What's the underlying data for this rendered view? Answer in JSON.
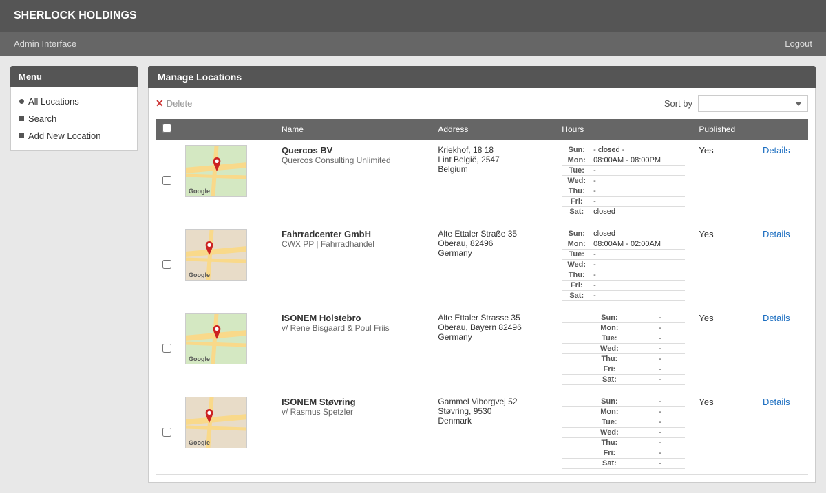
{
  "app": {
    "title": "SHERLOCK HOLDINGS",
    "sub_label": "Admin Interface",
    "logout_label": "Logout"
  },
  "sidebar": {
    "menu_label": "Menu",
    "items": [
      {
        "id": "all-locations",
        "label": "All Locations",
        "bullet": "circle"
      },
      {
        "id": "search",
        "label": "Search",
        "bullet": "square"
      },
      {
        "id": "add-new-location",
        "label": "Add New Location",
        "bullet": "square"
      }
    ]
  },
  "content": {
    "header": "Manage Locations",
    "toolbar": {
      "delete_label": "Delete",
      "sort_by_label": "Sort by"
    },
    "table": {
      "columns": [
        "",
        "",
        "Name",
        "Address",
        "Hours",
        "Published",
        ""
      ],
      "rows": [
        {
          "id": 1,
          "name": "Quercos BV",
          "subtitle": "Quercos Consulting Unlimited",
          "address_line1": "Kriekhof, 18 18",
          "address_line2": "Lint België, 2547",
          "address_line3": "Belgium",
          "hours": [
            {
              "day": "Sun:",
              "time": "- closed -"
            },
            {
              "day": "Mon:",
              "time": "08:00AM - 08:00PM"
            },
            {
              "day": "Tue:",
              "time": "-"
            },
            {
              "day": "Wed:",
              "time": "-"
            },
            {
              "day": "Thu:",
              "time": "-"
            },
            {
              "day": "Fri:",
              "time": "-"
            },
            {
              "day": "Sat:",
              "time": "closed"
            }
          ],
          "published": "Yes",
          "details": "Details"
        },
        {
          "id": 2,
          "name": "Fahrradcenter GmbH",
          "subtitle": "CWX PP | Fahrradhandel",
          "address_line1": "Alte Ettaler Straße 35",
          "address_line2": "Oberau, 82496",
          "address_line3": "Germany",
          "hours": [
            {
              "day": "Sun:",
              "time": "closed"
            },
            {
              "day": "Mon:",
              "time": "08:00AM - 02:00AM"
            },
            {
              "day": "Tue:",
              "time": "-"
            },
            {
              "day": "Wed:",
              "time": "-"
            },
            {
              "day": "Thu:",
              "time": "-"
            },
            {
              "day": "Fri:",
              "time": "-"
            },
            {
              "day": "Sat:",
              "time": "-"
            }
          ],
          "published": "Yes",
          "details": "Details"
        },
        {
          "id": 3,
          "name": "ISONEM Holstebro",
          "subtitle": "v/ Rene Bisgaard & Poul Friis",
          "address_line1": "Alte Ettaler Strasse 35",
          "address_line2": "Oberau, Bayern 82496",
          "address_line3": "Germany",
          "hours": [
            {
              "day": "Sun:",
              "time": "-"
            },
            {
              "day": "Mon:",
              "time": "-"
            },
            {
              "day": "Tue:",
              "time": "-"
            },
            {
              "day": "Wed:",
              "time": "-"
            },
            {
              "day": "Thu:",
              "time": "-"
            },
            {
              "day": "Fri:",
              "time": "-"
            },
            {
              "day": "Sat:",
              "time": "-"
            }
          ],
          "published": "Yes",
          "details": "Details"
        },
        {
          "id": 4,
          "name": "ISONEM Støvring",
          "subtitle": "v/ Rasmus Spetzler",
          "address_line1": "Gammel Viborgvej 52",
          "address_line2": "Støvring, 9530",
          "address_line3": "Denmark",
          "hours": [
            {
              "day": "Sun:",
              "time": "-"
            },
            {
              "day": "Mon:",
              "time": "-"
            },
            {
              "day": "Tue:",
              "time": "-"
            },
            {
              "day": "Wed:",
              "time": "-"
            },
            {
              "day": "Thu:",
              "time": "-"
            },
            {
              "day": "Fri:",
              "time": "-"
            },
            {
              "day": "Sat:",
              "time": "-"
            }
          ],
          "published": "Yes",
          "details": "Details"
        }
      ]
    }
  }
}
